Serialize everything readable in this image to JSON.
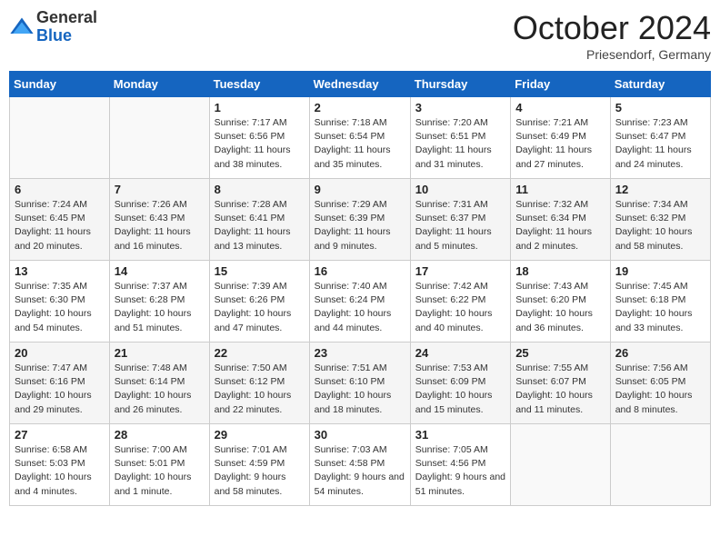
{
  "header": {
    "logo_general": "General",
    "logo_blue": "Blue",
    "month": "October 2024",
    "location": "Priesendorf, Germany"
  },
  "weekdays": [
    "Sunday",
    "Monday",
    "Tuesday",
    "Wednesday",
    "Thursday",
    "Friday",
    "Saturday"
  ],
  "weeks": [
    [
      {
        "day": "",
        "info": ""
      },
      {
        "day": "",
        "info": ""
      },
      {
        "day": "1",
        "info": "Sunrise: 7:17 AM\nSunset: 6:56 PM\nDaylight: 11 hours and 38 minutes."
      },
      {
        "day": "2",
        "info": "Sunrise: 7:18 AM\nSunset: 6:54 PM\nDaylight: 11 hours and 35 minutes."
      },
      {
        "day": "3",
        "info": "Sunrise: 7:20 AM\nSunset: 6:51 PM\nDaylight: 11 hours and 31 minutes."
      },
      {
        "day": "4",
        "info": "Sunrise: 7:21 AM\nSunset: 6:49 PM\nDaylight: 11 hours and 27 minutes."
      },
      {
        "day": "5",
        "info": "Sunrise: 7:23 AM\nSunset: 6:47 PM\nDaylight: 11 hours and 24 minutes."
      }
    ],
    [
      {
        "day": "6",
        "info": "Sunrise: 7:24 AM\nSunset: 6:45 PM\nDaylight: 11 hours and 20 minutes."
      },
      {
        "day": "7",
        "info": "Sunrise: 7:26 AM\nSunset: 6:43 PM\nDaylight: 11 hours and 16 minutes."
      },
      {
        "day": "8",
        "info": "Sunrise: 7:28 AM\nSunset: 6:41 PM\nDaylight: 11 hours and 13 minutes."
      },
      {
        "day": "9",
        "info": "Sunrise: 7:29 AM\nSunset: 6:39 PM\nDaylight: 11 hours and 9 minutes."
      },
      {
        "day": "10",
        "info": "Sunrise: 7:31 AM\nSunset: 6:37 PM\nDaylight: 11 hours and 5 minutes."
      },
      {
        "day": "11",
        "info": "Sunrise: 7:32 AM\nSunset: 6:34 PM\nDaylight: 11 hours and 2 minutes."
      },
      {
        "day": "12",
        "info": "Sunrise: 7:34 AM\nSunset: 6:32 PM\nDaylight: 10 hours and 58 minutes."
      }
    ],
    [
      {
        "day": "13",
        "info": "Sunrise: 7:35 AM\nSunset: 6:30 PM\nDaylight: 10 hours and 54 minutes."
      },
      {
        "day": "14",
        "info": "Sunrise: 7:37 AM\nSunset: 6:28 PM\nDaylight: 10 hours and 51 minutes."
      },
      {
        "day": "15",
        "info": "Sunrise: 7:39 AM\nSunset: 6:26 PM\nDaylight: 10 hours and 47 minutes."
      },
      {
        "day": "16",
        "info": "Sunrise: 7:40 AM\nSunset: 6:24 PM\nDaylight: 10 hours and 44 minutes."
      },
      {
        "day": "17",
        "info": "Sunrise: 7:42 AM\nSunset: 6:22 PM\nDaylight: 10 hours and 40 minutes."
      },
      {
        "day": "18",
        "info": "Sunrise: 7:43 AM\nSunset: 6:20 PM\nDaylight: 10 hours and 36 minutes."
      },
      {
        "day": "19",
        "info": "Sunrise: 7:45 AM\nSunset: 6:18 PM\nDaylight: 10 hours and 33 minutes."
      }
    ],
    [
      {
        "day": "20",
        "info": "Sunrise: 7:47 AM\nSunset: 6:16 PM\nDaylight: 10 hours and 29 minutes."
      },
      {
        "day": "21",
        "info": "Sunrise: 7:48 AM\nSunset: 6:14 PM\nDaylight: 10 hours and 26 minutes."
      },
      {
        "day": "22",
        "info": "Sunrise: 7:50 AM\nSunset: 6:12 PM\nDaylight: 10 hours and 22 minutes."
      },
      {
        "day": "23",
        "info": "Sunrise: 7:51 AM\nSunset: 6:10 PM\nDaylight: 10 hours and 18 minutes."
      },
      {
        "day": "24",
        "info": "Sunrise: 7:53 AM\nSunset: 6:09 PM\nDaylight: 10 hours and 15 minutes."
      },
      {
        "day": "25",
        "info": "Sunrise: 7:55 AM\nSunset: 6:07 PM\nDaylight: 10 hours and 11 minutes."
      },
      {
        "day": "26",
        "info": "Sunrise: 7:56 AM\nSunset: 6:05 PM\nDaylight: 10 hours and 8 minutes."
      }
    ],
    [
      {
        "day": "27",
        "info": "Sunrise: 6:58 AM\nSunset: 5:03 PM\nDaylight: 10 hours and 4 minutes."
      },
      {
        "day": "28",
        "info": "Sunrise: 7:00 AM\nSunset: 5:01 PM\nDaylight: 10 hours and 1 minute."
      },
      {
        "day": "29",
        "info": "Sunrise: 7:01 AM\nSunset: 4:59 PM\nDaylight: 9 hours and 58 minutes."
      },
      {
        "day": "30",
        "info": "Sunrise: 7:03 AM\nSunset: 4:58 PM\nDaylight: 9 hours and 54 minutes."
      },
      {
        "day": "31",
        "info": "Sunrise: 7:05 AM\nSunset: 4:56 PM\nDaylight: 9 hours and 51 minutes."
      },
      {
        "day": "",
        "info": ""
      },
      {
        "day": "",
        "info": ""
      }
    ]
  ]
}
